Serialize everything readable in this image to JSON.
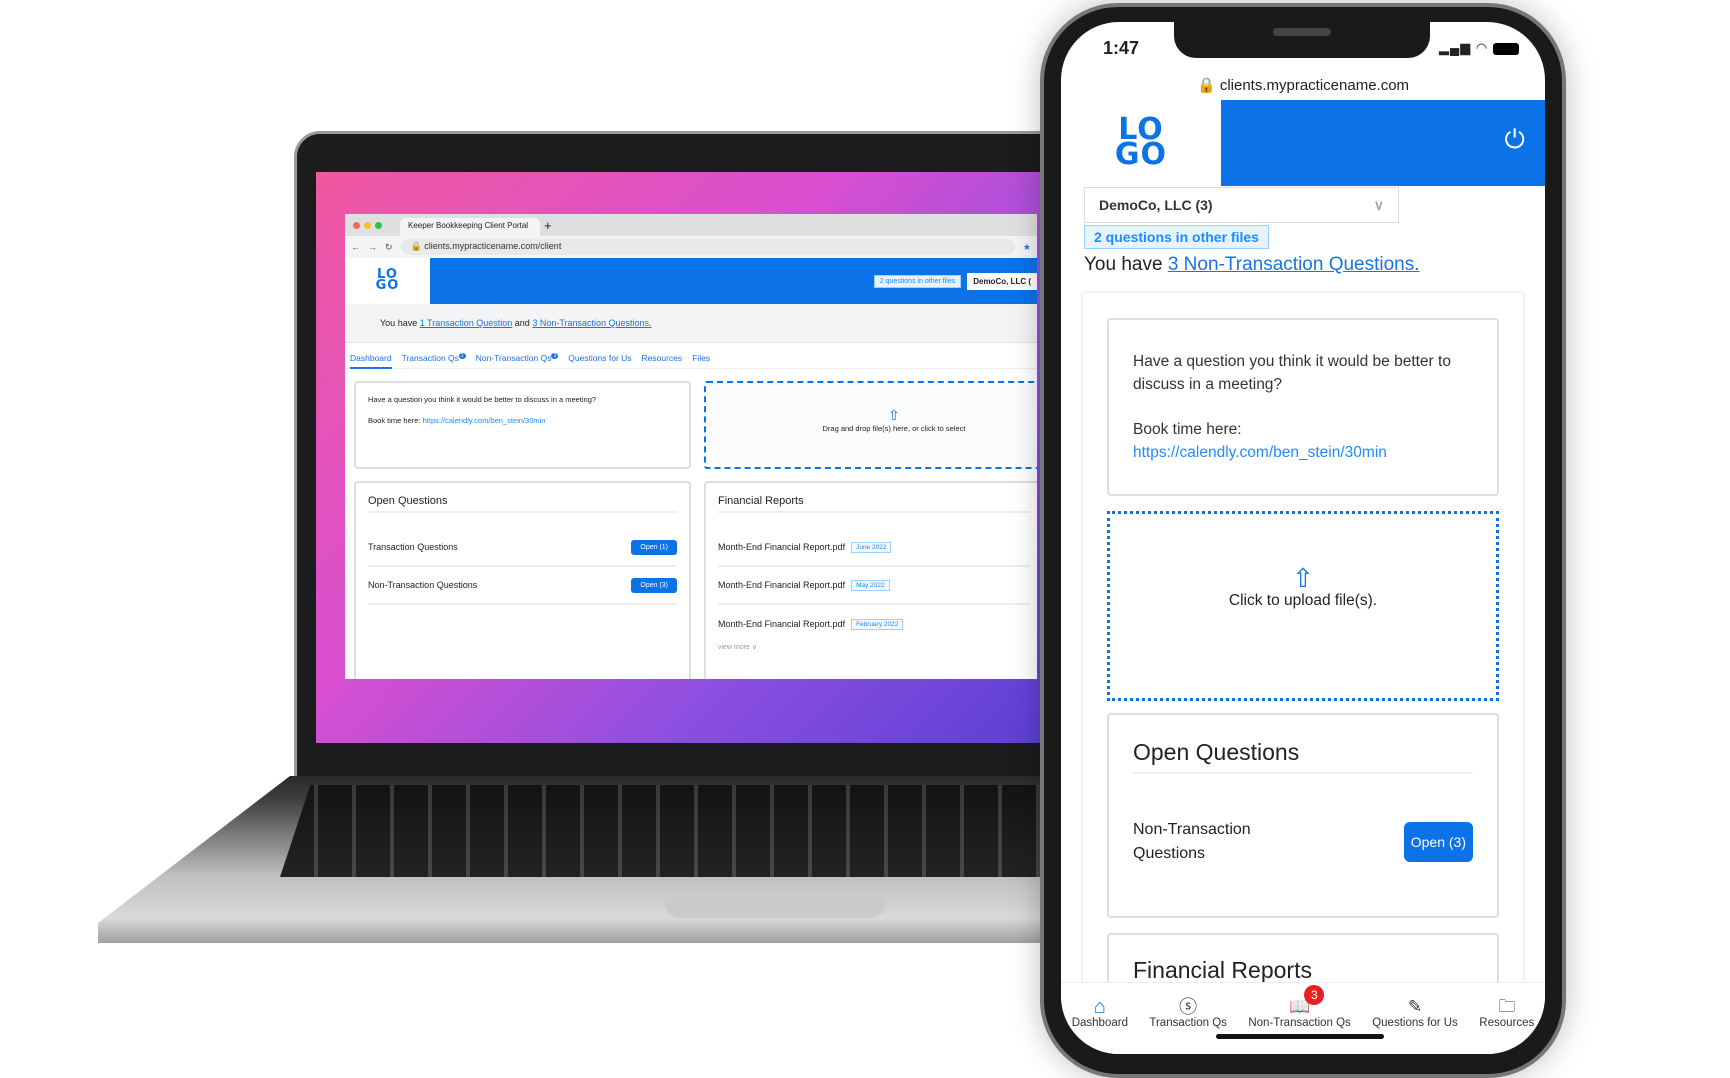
{
  "laptop": {
    "tab_title": "Keeper Bookkeeping Client Portal",
    "url": "clients.mypracticename.com/client",
    "logo": "LO GO",
    "other_files_badge": "2 questions in other files",
    "company_select": "DemoCo, LLC (",
    "intro": {
      "prefix": "You have ",
      "link1": "1 Transaction Question",
      "mid": " and ",
      "link2": "3 Non-Transaction Questions."
    },
    "tabs": [
      {
        "label": "Dashboard",
        "active": true
      },
      {
        "label": "Transaction Qs",
        "badge": "1"
      },
      {
        "label": "Non-Transaction Qs",
        "badge": "3"
      },
      {
        "label": "Questions for Us"
      },
      {
        "label": "Resources"
      },
      {
        "label": "Files"
      }
    ],
    "meeting": {
      "question": "Have a question you think it would be better to discuss in a meeting?",
      "book_label": "Book time here: ",
      "book_link": "https://calendly.com/ben_stein/30min"
    },
    "upload_text": "Drag and drop file(s) here, or click to select",
    "open_questions": {
      "title": "Open Questions",
      "rows": [
        {
          "label": "Transaction Questions",
          "button": "Open (1)"
        },
        {
          "label": "Non-Transaction Questions",
          "button": "Open (3)"
        }
      ]
    },
    "financial_reports": {
      "title": "Financial Reports",
      "rows": [
        {
          "file": "Month-End Financial Report.pdf",
          "tag": "June 2022"
        },
        {
          "file": "Month-End Financial Report.pdf",
          "tag": "May 2022"
        },
        {
          "file": "Month-End Financial Report.pdf",
          "tag": "February 2022"
        }
      ],
      "view_more": "view more ∨"
    }
  },
  "phone": {
    "time": "1:47",
    "url": "clients.mypracticename.com",
    "logo": "LO GO",
    "company_select": "DemoCo, LLC (3)",
    "other_files_badge": "2 questions in other files",
    "intro": {
      "prefix": "You have ",
      "link": "3 Non-Transaction Questions."
    },
    "meeting": {
      "question": "Have a question you think it would be better to discuss in a meeting?",
      "book_label": "Book time here:",
      "book_link": "https://calendly.com/ben_stein/30min"
    },
    "upload_text": "Click to upload file(s).",
    "open_questions": {
      "title": "Open Questions",
      "row_label": "Non-Transaction Questions",
      "button": "Open (3)"
    },
    "financial_reports_title": "Financial Reports",
    "nav": [
      {
        "label": "Dashboard",
        "icon": "home-icon",
        "active": true
      },
      {
        "label": "Transaction Qs",
        "icon": "dollar-circle-icon"
      },
      {
        "label": "Non-Transaction Qs",
        "icon": "book-icon",
        "badge": "3"
      },
      {
        "label": "Questions for Us",
        "icon": "pencil-icon"
      },
      {
        "label": "Resources",
        "icon": "folder-icon"
      }
    ]
  },
  "colors": {
    "brand": "#0b72e7",
    "badge": "#e6f3ff",
    "notification": "#e8201f"
  }
}
